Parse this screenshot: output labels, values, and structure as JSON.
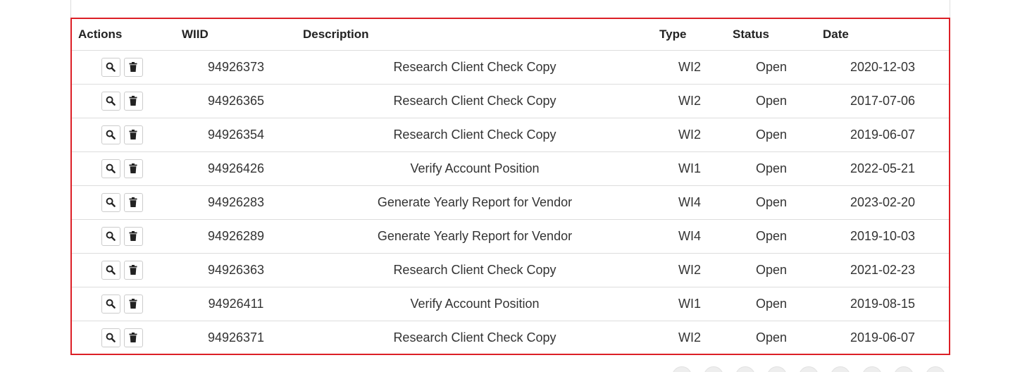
{
  "table": {
    "headers": {
      "actions": "Actions",
      "wiid": "WIID",
      "description": "Description",
      "type": "Type",
      "status": "Status",
      "date": "Date"
    },
    "row_actions": [
      "search-icon",
      "trash-icon"
    ],
    "rows": [
      {
        "wiid": "94926373",
        "description": "Research Client Check Copy",
        "type": "WI2",
        "status": "Open",
        "date": "2020-12-03"
      },
      {
        "wiid": "94926365",
        "description": "Research Client Check Copy",
        "type": "WI2",
        "status": "Open",
        "date": "2017-07-06"
      },
      {
        "wiid": "94926354",
        "description": "Research Client Check Copy",
        "type": "WI2",
        "status": "Open",
        "date": "2019-06-07"
      },
      {
        "wiid": "94926426",
        "description": "Verify Account Position",
        "type": "WI1",
        "status": "Open",
        "date": "2022-05-21"
      },
      {
        "wiid": "94926283",
        "description": "Generate Yearly Report for Vendor",
        "type": "WI4",
        "status": "Open",
        "date": "2023-02-20"
      },
      {
        "wiid": "94926289",
        "description": "Generate Yearly Report for Vendor",
        "type": "WI4",
        "status": "Open",
        "date": "2019-10-03"
      },
      {
        "wiid": "94926363",
        "description": "Research Client Check Copy",
        "type": "WI2",
        "status": "Open",
        "date": "2021-02-23"
      },
      {
        "wiid": "94926411",
        "description": "Verify Account Position",
        "type": "WI1",
        "status": "Open",
        "date": "2019-08-15"
      },
      {
        "wiid": "94926371",
        "description": "Research Client Check Copy",
        "type": "WI2",
        "status": "Open",
        "date": "2019-06-07"
      }
    ]
  },
  "colors": {
    "highlight_border": "#dc1f26",
    "row_divider": "#dddddd",
    "text": "#333333"
  }
}
